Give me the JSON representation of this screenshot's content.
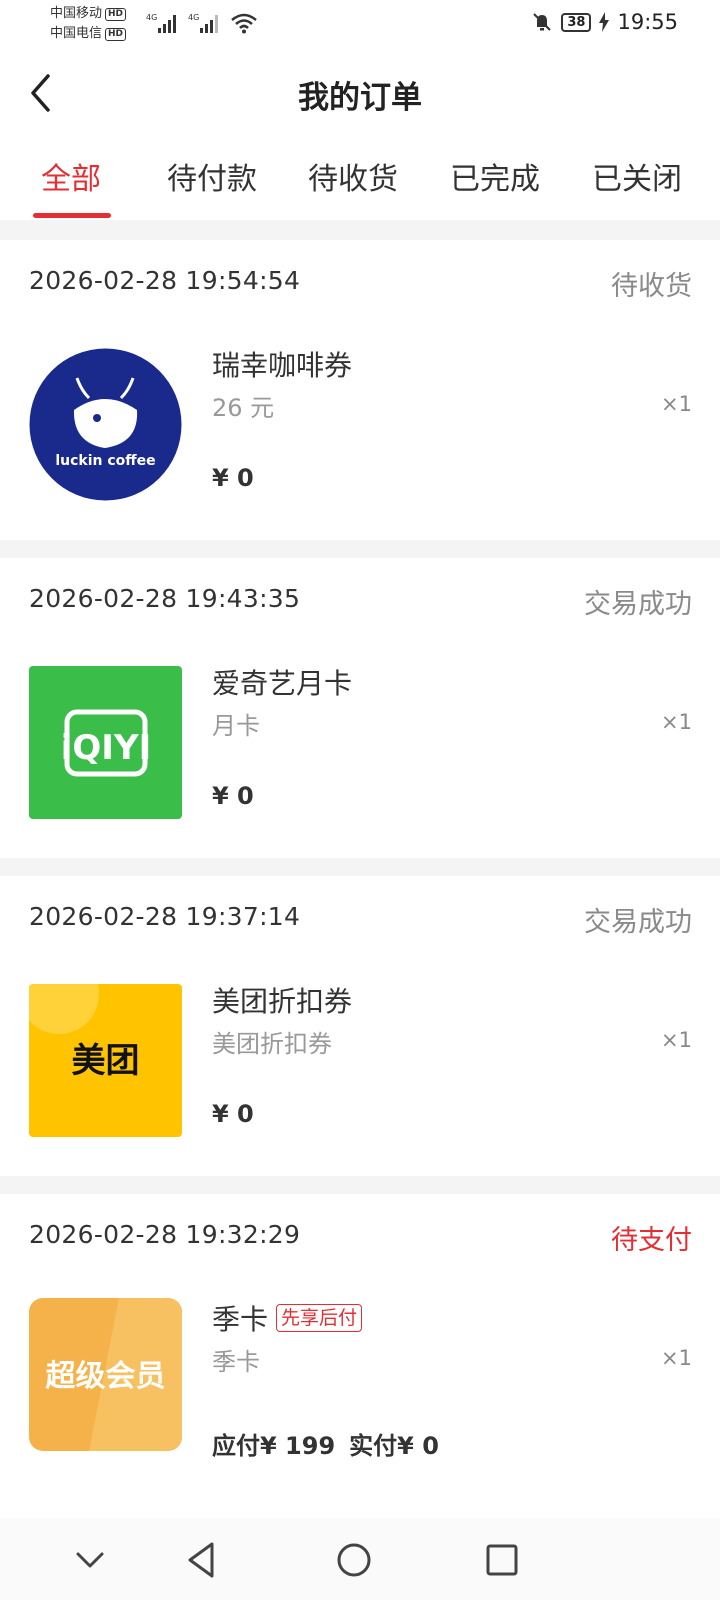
{
  "status_bar": {
    "carrier1": "中国移动",
    "carrier2": "中国电信",
    "hd": "HD",
    "network": "4G",
    "battery": "38",
    "time": "19:55"
  },
  "header": {
    "title": "我的订单"
  },
  "tabs": [
    {
      "label": "全部",
      "active": true
    },
    {
      "label": "待付款",
      "active": false
    },
    {
      "label": "待收货",
      "active": false
    },
    {
      "label": "已完成",
      "active": false
    },
    {
      "label": "已关闭",
      "active": false
    }
  ],
  "orders": [
    {
      "time": "2026-02-28 19:54:54",
      "status": "待收货",
      "name": "瑞幸咖啡券",
      "spec": "26 元",
      "qty": "×1",
      "price": "¥ 0",
      "thumb_text": "luckin coffee",
      "thumb_color": "#1a2a8c"
    },
    {
      "time": "2026-02-28 19:43:35",
      "status": "交易成功",
      "name": "爱奇艺月卡",
      "spec": "月卡",
      "qty": "×1",
      "price": "¥ 0",
      "thumb_text": "iQIYI",
      "thumb_color": "#3bbd4a"
    },
    {
      "time": "2026-02-28 19:37:14",
      "status": "交易成功",
      "name": "美团折扣券",
      "spec": "美团折扣券",
      "qty": "×1",
      "price": "¥ 0",
      "thumb_text": "美团",
      "thumb_color": "#ffc300"
    },
    {
      "time": "2026-02-28 19:32:29",
      "status": "待支付",
      "name": "季卡",
      "badge": "先享后付",
      "spec": "季卡",
      "qty": "×1",
      "price_due": "应付¥ 199",
      "price_paid": "实付¥ 0",
      "thumb_text": "超级会员",
      "thumb_color": "#f5b24a"
    }
  ],
  "colors": {
    "accent": "#e52e34",
    "muted": "#8a8a8a"
  }
}
